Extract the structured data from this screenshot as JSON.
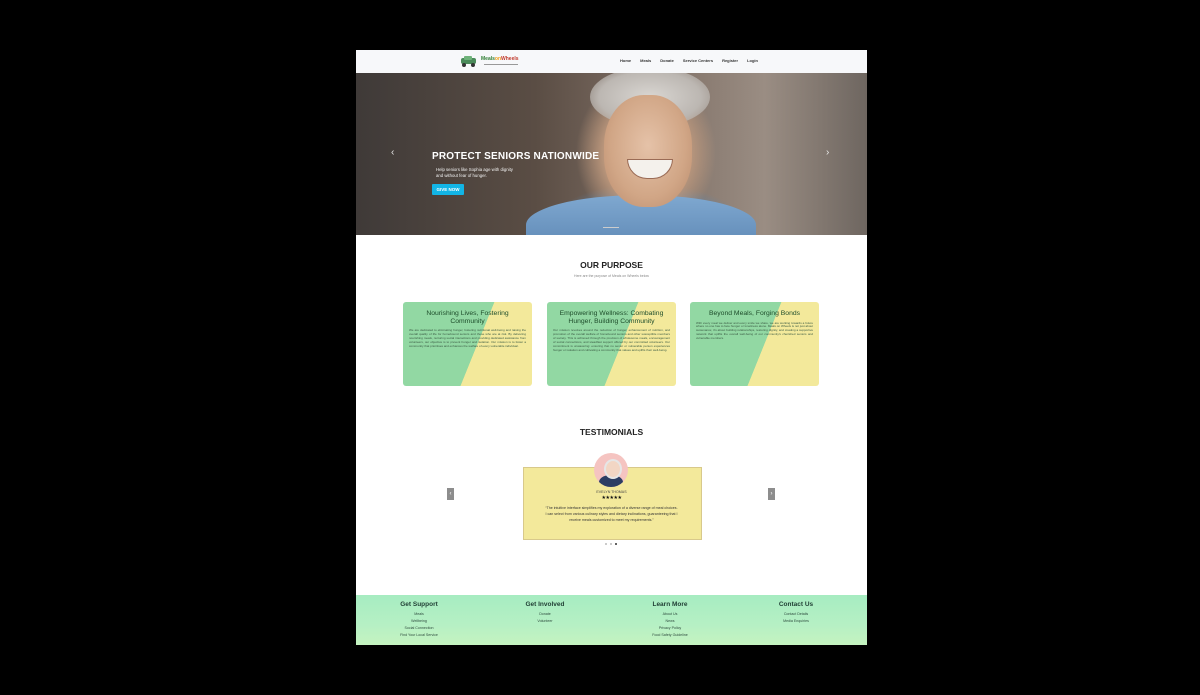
{
  "nav": {
    "logo_text": [
      "Meals",
      "on",
      "Wheels"
    ],
    "items": [
      "Home",
      "Meals",
      "Donate",
      "Service Centers",
      "Register",
      "Login"
    ]
  },
  "hero": {
    "title": "PROTECT SENIORS NATIONWIDE",
    "subtitle": "Help seniors like Sophia age with dignity and without fear of hunger.",
    "cta": "GIVE NOW",
    "prev_icon": "‹",
    "next_icon": "›"
  },
  "purpose": {
    "title": "OUR PURPOSE",
    "subtitle": "Here are the purpose of Meals on Wheels below",
    "cards": [
      {
        "title": "Nourishing Lives, Fostering Community",
        "body": "We are dedicated to eliminating hunger, fostering nutritional well-being and raising the overall quality of life for homebound seniors and those who are at risk. By delivering nourishing meals, nurturing social interactions and providing dedicated assistance from volunteers, our objective is to prevent hunger and isolation. Our mission is to foster a community that prioritises and enhances the welfare of every vulnerable individual."
      },
      {
        "title": "Empowering Wellness: Combating Hunger, Building Community",
        "body": "Our mission revolves around the reduction of hunger, enhancement of nutrition, and promotion of the overall welfare of homebound seniors and other susceptible members of society. This is achieved through the provision of wholesome meals, encouragement of social connections, and steadfast support offered by our committed volunteers. Our commitment is unwavering: ensuring that no senior or vulnerable person experiences hunger or isolation and cultivating a community that values and uplifts their well-being."
      },
      {
        "title": "Beyond Meals, Forging Bonds",
        "body": "With every meal we deliver and every smile we share, we are working towards a future where no one has to face hunger or loneliness alone. Meals on Wheels is not just about sustenance; it's about building relationships, restoring dignity, and creating a supportive network that uplifts the overall well-being of our community's cherished seniors and vulnerable members."
      }
    ]
  },
  "testimonials": {
    "title": "TESTIMONIALS",
    "name": "EVELYN THOMAS",
    "stars": "★★★★★",
    "quote": "“The intuitive interface simplifies my exploration of a diverse range of meal choices. I can select from various culinary styles and dietary inclinations, guaranteeing that I receive meals customized to meet my requirements.”",
    "prev_icon": "‹",
    "next_icon": "›"
  },
  "footer": {
    "columns": [
      {
        "title": "Get Support",
        "links": [
          "Meals",
          "Wellbeing",
          "Social Connection",
          "Find Your Local Service"
        ]
      },
      {
        "title": "Get Involved",
        "links": [
          "Donate",
          "Volunteer"
        ]
      },
      {
        "title": "Learn More",
        "links": [
          "About Us",
          "News",
          "Privacy Policy",
          "Food Safety Guideline"
        ]
      },
      {
        "title": "Contact Us",
        "links": [
          "Contact Details",
          "Media Enquiries"
        ]
      }
    ]
  },
  "colors": {
    "accent": "#12b5e6",
    "card_green": "#92d8a3",
    "card_yellow": "#f3e99b",
    "footer_green": "#a6ecc1"
  }
}
